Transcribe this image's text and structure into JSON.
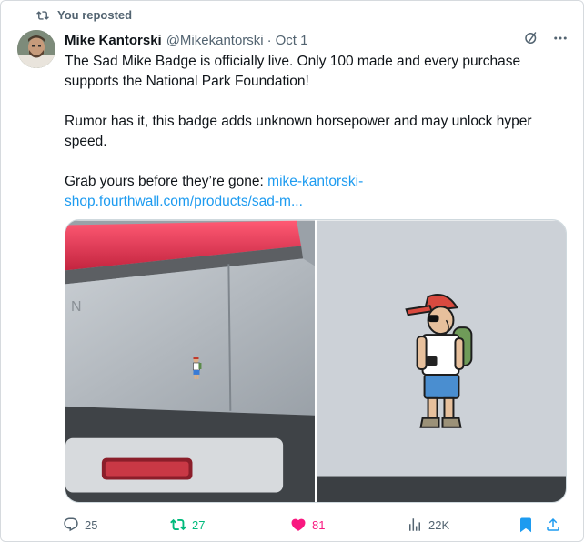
{
  "repost": {
    "text": "You reposted",
    "icon": "retweet-icon"
  },
  "author": {
    "name": "Mike Kantorski",
    "handle": "@Mikekantorski",
    "separator": "·",
    "date": "Oct 1"
  },
  "tweet": {
    "line1": "The Sad Mike Badge is officially live. Only 100 made and every purchase supports the National Park Foundation!",
    "line2": "Rumor has it, this badge adds unknown horsepower and may unlock hyper speed.",
    "line3_prefix": "Grab yours before they’re gone: ",
    "link": "mike-kantorski-shop.fourthwall.com/products/sad-m..."
  },
  "media": {
    "left_image": "truck-tailgate-with-badge",
    "right_image": "sad-mike-badge-closeup"
  },
  "actions": {
    "replies": "25",
    "reposts": "27",
    "likes": "81",
    "views": "22K"
  },
  "colors": {
    "accent": "#1d9bf0",
    "repost_active": "#00ba7c",
    "like_active": "#f91880",
    "secondary_text": "#536471"
  }
}
